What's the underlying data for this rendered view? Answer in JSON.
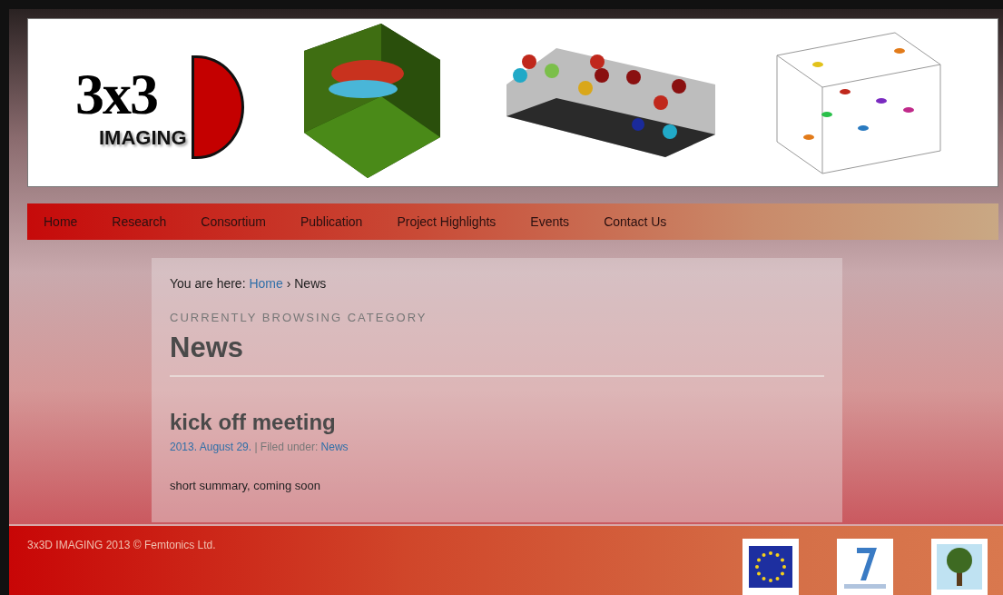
{
  "logo": {
    "main": "3x3",
    "sub": "IMAGING"
  },
  "nav": [
    "Home",
    "Research",
    "Consortium",
    "Publication",
    "Project Highlights",
    "Events",
    "Contact Us"
  ],
  "breadcrumb": {
    "prefix": "You are here:",
    "home": "Home",
    "separator": "›",
    "current": "News"
  },
  "category": {
    "label": "CURRENTLY BROWSING CATEGORY",
    "title": "News"
  },
  "posts": [
    {
      "title": "kick off meeting",
      "date": "2013. August 29.",
      "filed_label": "| Filed under:",
      "category": "News",
      "summary": "short summary, coming soon"
    }
  ],
  "footer": {
    "copyright": "3x3D IMAGING 2013 © Femtonics Ltd."
  }
}
